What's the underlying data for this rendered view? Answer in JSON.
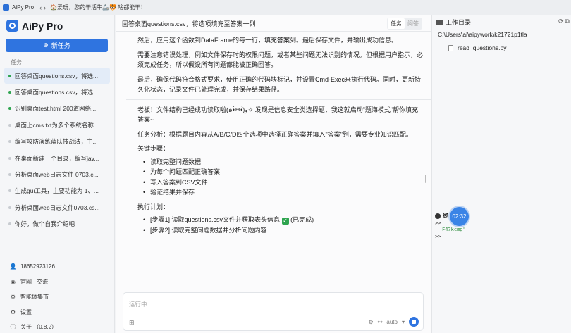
{
  "window": {
    "app_name": "AiPy Pro",
    "marquee": "🏠爱玩，您的干活牛🦾🐯 啥都能干！"
  },
  "sidebar": {
    "brand": "AiPy Pro",
    "new_task_label": "新任务",
    "section_label": "任务",
    "tasks": [
      {
        "label": "回答桌面questions.csv，将选...",
        "status": "done",
        "active": true
      },
      {
        "label": "回答桌面questions.csv，将选...",
        "status": "done",
        "active": false
      },
      {
        "label": "识别桌面test.html 200道网络...",
        "status": "done",
        "active": false
      },
      {
        "label": "桌面上cms.txt为多个系统名称...",
        "status": "none",
        "active": false
      },
      {
        "label": "编写攻防演练蓝队技战法，主...",
        "status": "none",
        "active": false
      },
      {
        "label": "在桌面新建一个目录，编写jav...",
        "status": "none",
        "active": false
      },
      {
        "label": "分析桌面web日志文件 0703.c...",
        "status": "none",
        "active": false
      },
      {
        "label": "生成gui工具，主要功能为 1、...",
        "status": "none",
        "active": false
      },
      {
        "label": "分析桌面web日志文件0703.cs...",
        "status": "none",
        "active": false
      },
      {
        "label": "你好，做个自我介绍吧",
        "status": "none",
        "active": false
      }
    ],
    "footer": [
      {
        "icon": "user-icon",
        "label": "18652923126"
      },
      {
        "icon": "globe-icon",
        "label": "官网 · 交流"
      },
      {
        "icon": "bot-icon",
        "label": "智能体集市"
      },
      {
        "icon": "gear-icon",
        "label": "设置"
      },
      {
        "icon": "info-icon",
        "label": "关于 （0.8.2）"
      }
    ]
  },
  "main": {
    "title": "回答桌面questions.csv，将选项填充至答案一列",
    "tabs": [
      {
        "label": "任务",
        "active": true
      },
      {
        "label": "问答",
        "active": false
      }
    ],
    "paragraphs_top": [
      "然后，应用这个函数到DataFrame的每一行，填充答案列。最后保存文件，并输出成功信息。",
      "需要注意错误处理，例如文件保存时的权限问题，或者某些问题无法识别的情况。但根据用户指示，必须完成任务，所以假设所有问题都能被正确回答。",
      "最后，确保代码符合格式要求，使用正确的代码块标记，并设置Cmd-Exec来执行代码。同时，更新持久化状态，记录文件已处理完成，并保存结果路径。"
    ],
    "reply_intro": "老板！文件结构已经成功读取啦(๑•̀ㅂ•́)و✧ 发现是信息安全类选择题，我这就启动\"题海模式\"帮你填充答案~",
    "analysis": "任务分析：根据题目内容从A/B/C/D四个选项中选择正确答案并填入\"答案\"列，需要专业知识匹配。",
    "steps_title": "关键步骤：",
    "steps": [
      "读取完整问题数据",
      "为每个问题匹配正确答案",
      "写入答案到CSV文件",
      "验证结果并保存"
    ],
    "plan_title": "执行计划：",
    "plan": [
      {
        "text": "[步骤1] 读取questions.csv文件并获取表头信息",
        "done_label": "(已完成)",
        "done": true
      },
      {
        "text": "[步骤2] 读取完整问题数据并分析问题内容",
        "done_label": "",
        "done": false
      }
    ],
    "input_placeholder": "运行中...",
    "model_select": "auto"
  },
  "workspace": {
    "title": "工作目录",
    "path": "C:\\Users\\ai\\aipywork\\k21721p1tla",
    "files": [
      "read_questions.py"
    ],
    "terminal_title": "终",
    "terminal_lines": [
      ">>",
      "F47kcmg\"",
      ">>"
    ],
    "timer": "02:32"
  },
  "colors": {
    "accent": "#2f74e0",
    "active_task_bg": "#e3ecf8",
    "done_dot": "#2ea44f"
  }
}
